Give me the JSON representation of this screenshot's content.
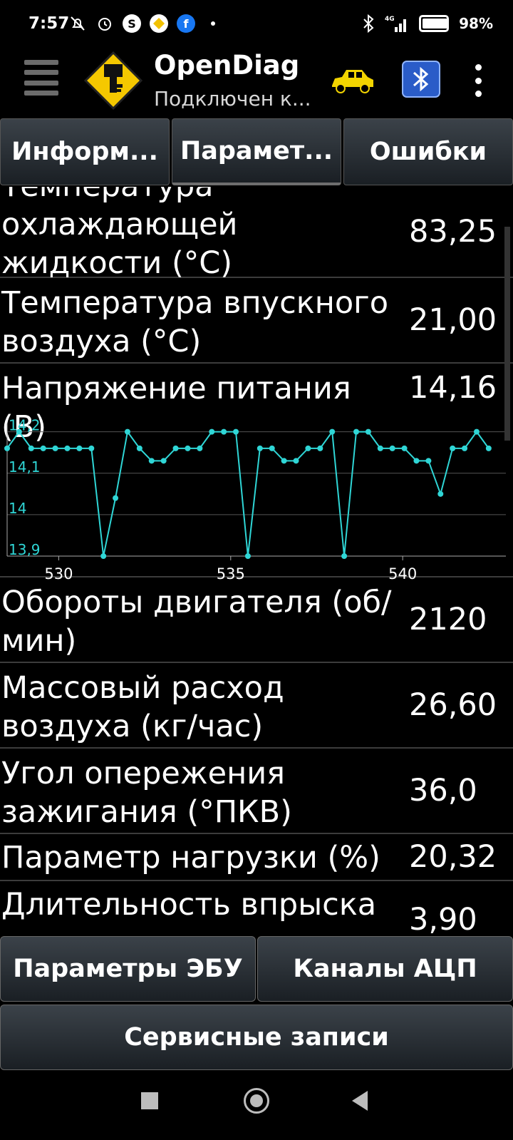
{
  "status_bar": {
    "time": "7:57",
    "battery": "98%",
    "battery_level": 0.98
  },
  "app": {
    "title": "OpenDiag",
    "subtitle": "Подключен к..."
  },
  "tabs": [
    {
      "label": "Информ..."
    },
    {
      "label": "Парамет..."
    },
    {
      "label": "Ошибки"
    }
  ],
  "params": [
    {
      "name": "Температура охлаждающей жидкости (°C)",
      "value": "83,25",
      "name_visible": "охлаждающей жидкости (°C)",
      "name_cut": "Температура"
    },
    {
      "name": "Температура впускного воздуха (°C)",
      "value": "21,00"
    },
    {
      "name": "Напряжение питания (В)",
      "value": "14,16"
    },
    {
      "name": "Обороты двигателя (об/мин)",
      "value": "2120"
    },
    {
      "name": "Массовый расход воздуха (кг/час)",
      "value": "26,60"
    },
    {
      "name": "Угол опережения зажигания (°ПКВ)",
      "value": "36,0"
    },
    {
      "name": "Параметр нагрузки (%)",
      "value": "20,32"
    },
    {
      "name": "Длительность впрыска",
      "value": "3,90"
    }
  ],
  "chart_data": {
    "type": "line",
    "series": [
      {
        "values": [
          14.16,
          14.2,
          14.16,
          14.16,
          14.16,
          14.16,
          14.16,
          14.16,
          13.9,
          14.04,
          14.2,
          14.16,
          14.13,
          14.13,
          14.16,
          14.16,
          14.16,
          14.2,
          14.2,
          14.2,
          13.9,
          14.16,
          14.16,
          14.13,
          14.13,
          14.16,
          14.16,
          14.2,
          13.9,
          14.2,
          14.2,
          14.16,
          14.16,
          14.16,
          14.13,
          14.13,
          14.05,
          14.16,
          14.16,
          14.2,
          14.16
        ]
      }
    ],
    "x_start": 528.5,
    "x_step": 0.35,
    "xticks": [
      530,
      535,
      540
    ],
    "yticks": [
      {
        "v": 13.9,
        "label": "13,9"
      },
      {
        "v": 14.0,
        "label": "14"
      },
      {
        "v": 14.1,
        "label": "14,1"
      },
      {
        "v": 14.2,
        "label": "14,2"
      }
    ],
    "ylim": [
      13.9,
      14.22
    ],
    "xlim": [
      528.5,
      543.0
    ],
    "color": "#2fd6d6"
  },
  "bottom_buttons": {
    "ecu_params": "Параметры ЭБУ",
    "adc_channels": "Каналы АЦП",
    "service_records": "Сервисные записи"
  }
}
